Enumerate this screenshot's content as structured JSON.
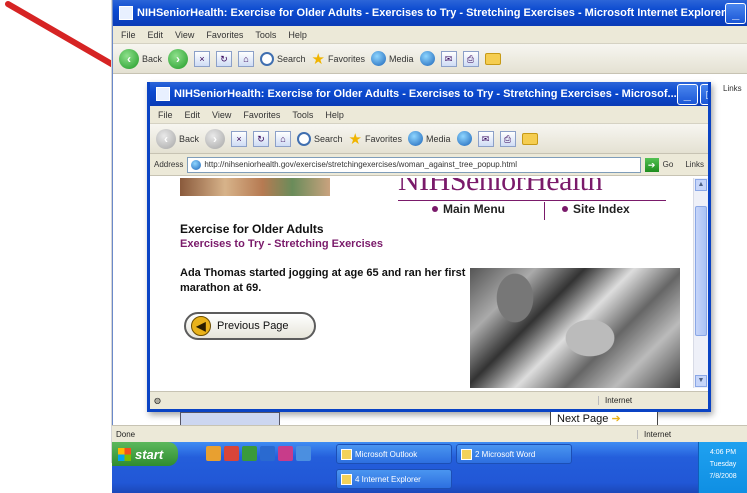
{
  "outer_window": {
    "title": "NIHSeniorHealth: Exercise for Older Adults - Exercises to Try - Stretching Exercises - Microsoft Internet Explorer",
    "menu": [
      "File",
      "Edit",
      "View",
      "Favorites",
      "Tools",
      "Help"
    ],
    "toolbar": {
      "back": "Back",
      "search": "Search",
      "favorites": "Favorites",
      "media": "Media"
    },
    "links": "Links",
    "status": "Done",
    "zone": "Internet",
    "next_page": "Next Page"
  },
  "inner_window": {
    "title": "NIHSeniorHealth: Exercise for Older Adults - Exercises to Try - Stretching Exercises - Microsof...",
    "menu": [
      "File",
      "Edit",
      "View",
      "Favorites",
      "Tools",
      "Help"
    ],
    "toolbar": {
      "back": "Back",
      "search": "Search",
      "favorites": "Favorites",
      "media": "Media"
    },
    "address_label": "Address",
    "url": "http://nihseniorhealth.gov/exercise/stretchingexercises/woman_against_tree_popup.html",
    "go": "Go",
    "links": "Links",
    "zone": "Internet"
  },
  "page": {
    "logo": "NIHSeniorHealth",
    "main_menu": "Main Menu",
    "site_index": "Site Index",
    "heading": "Exercise for Older Adults",
    "subheading": "Exercises to Try - Stretching Exercises",
    "body": "Ada Thomas started jogging at age 65 and ran her first marathon at 69.",
    "previous_page": "Previous Page"
  },
  "taskbar": {
    "start": "start",
    "tasks": [
      "Microsoft Outlook",
      "2 Microsoft Word",
      "4 Internet Explorer"
    ],
    "clock": "4:06 PM",
    "day": "Tuesday",
    "date": "7/8/2008"
  }
}
